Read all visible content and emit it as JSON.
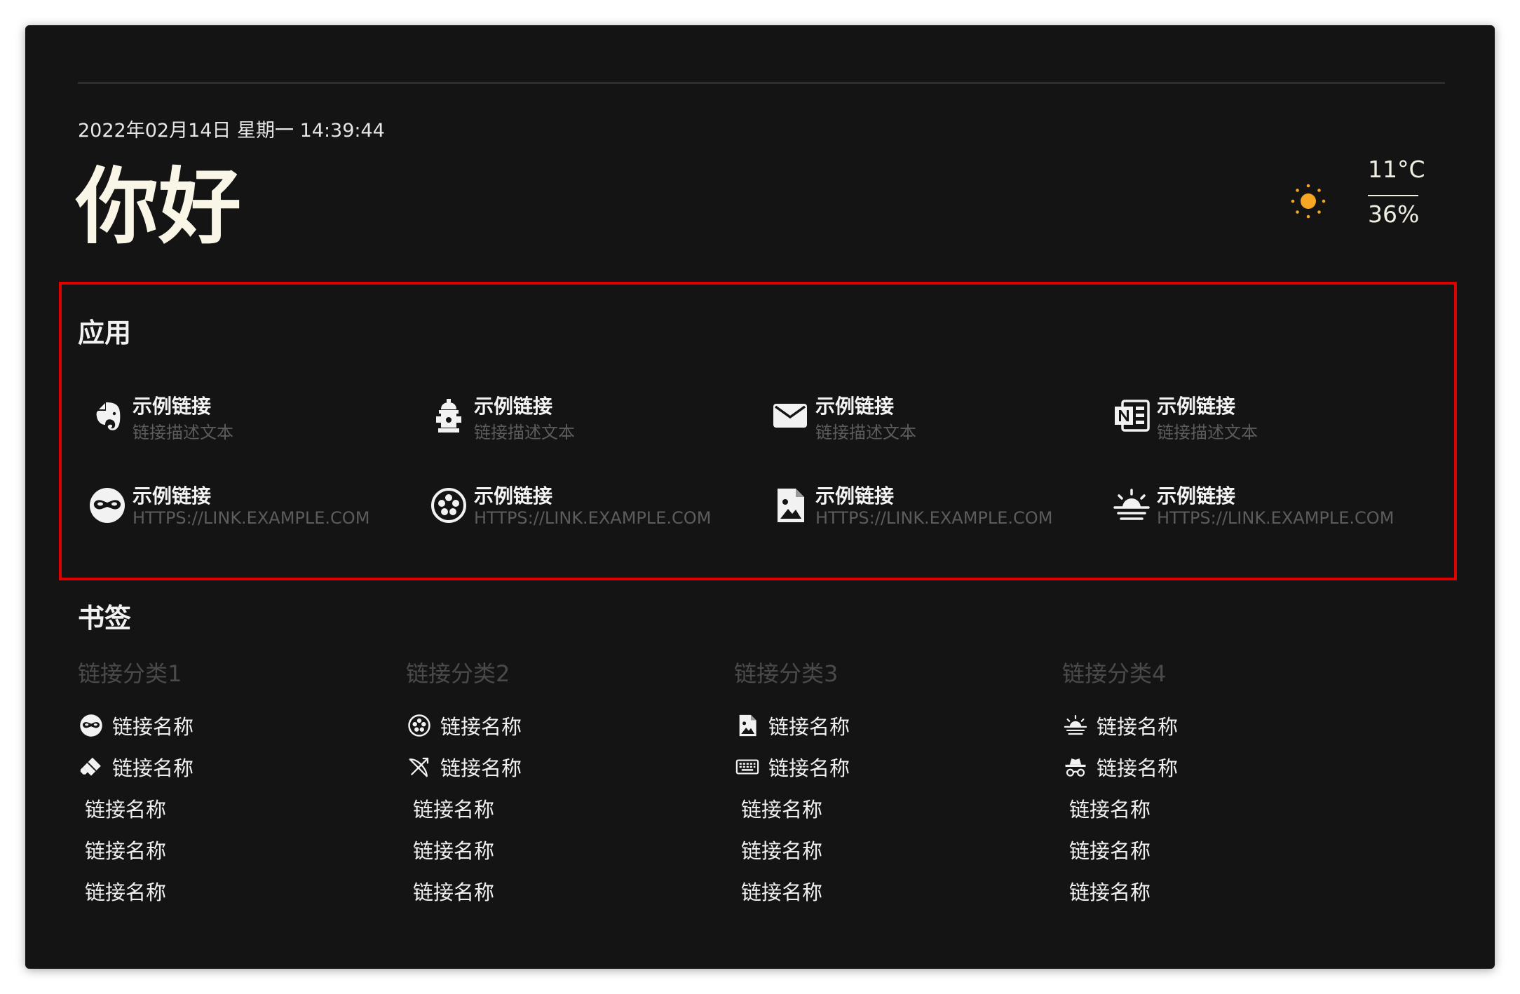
{
  "header": {
    "datetime": "2022年02月14日 星期一 14:39:44",
    "greeting": "你好"
  },
  "weather": {
    "icon": "sun-icon",
    "temperature": "11°C",
    "humidity": "36%",
    "icon_color": "#f5a623"
  },
  "apps": {
    "title": "应用",
    "items": [
      {
        "icon": "evernote-icon",
        "title": "示例链接",
        "desc": "链接描述文本"
      },
      {
        "icon": "fire-hydrant-icon",
        "title": "示例链接",
        "desc": "链接描述文本"
      },
      {
        "icon": "mail-icon",
        "title": "示例链接",
        "desc": "链接描述文本"
      },
      {
        "icon": "onenote-icon",
        "title": "示例链接",
        "desc": "链接描述文本"
      },
      {
        "icon": "domino-mask-icon",
        "title": "示例链接",
        "desc": "HTTPS://LINK.EXAMPLE.COM"
      },
      {
        "icon": "film-reel-icon",
        "title": "示例链接",
        "desc": "HTTPS://LINK.EXAMPLE.COM"
      },
      {
        "icon": "file-image-icon",
        "title": "示例链接",
        "desc": "HTTPS://LINK.EXAMPLE.COM"
      },
      {
        "icon": "sunrise-icon",
        "title": "示例链接",
        "desc": "HTTPS://LINK.EXAMPLE.COM"
      }
    ]
  },
  "bookmarks": {
    "title": "书签",
    "categories": [
      {
        "name": "链接分类1",
        "links": [
          {
            "icon": "domino-mask-icon",
            "label": "链接名称"
          },
          {
            "icon": "eraser-icon",
            "label": "链接名称"
          },
          {
            "icon": "",
            "label": "链接名称"
          },
          {
            "icon": "",
            "label": "链接名称"
          },
          {
            "icon": "",
            "label": "链接名称"
          }
        ]
      },
      {
        "name": "链接分类2",
        "links": [
          {
            "icon": "film-reel-icon",
            "label": "链接名称"
          },
          {
            "icon": "bow-arrow-icon",
            "label": "链接名称"
          },
          {
            "icon": "",
            "label": "链接名称"
          },
          {
            "icon": "",
            "label": "链接名称"
          },
          {
            "icon": "",
            "label": "链接名称"
          }
        ]
      },
      {
        "name": "链接分类3",
        "links": [
          {
            "icon": "file-image-icon",
            "label": "链接名称"
          },
          {
            "icon": "keyboard-icon",
            "label": "链接名称"
          },
          {
            "icon": "",
            "label": "链接名称"
          },
          {
            "icon": "",
            "label": "链接名称"
          },
          {
            "icon": "",
            "label": "链接名称"
          }
        ]
      },
      {
        "name": "链接分类4",
        "links": [
          {
            "icon": "sunrise-icon",
            "label": "链接名称"
          },
          {
            "icon": "incognito-icon",
            "label": "链接名称"
          },
          {
            "icon": "",
            "label": "链接名称"
          },
          {
            "icon": "",
            "label": "链接名称"
          },
          {
            "icon": "",
            "label": "链接名称"
          }
        ]
      }
    ]
  }
}
